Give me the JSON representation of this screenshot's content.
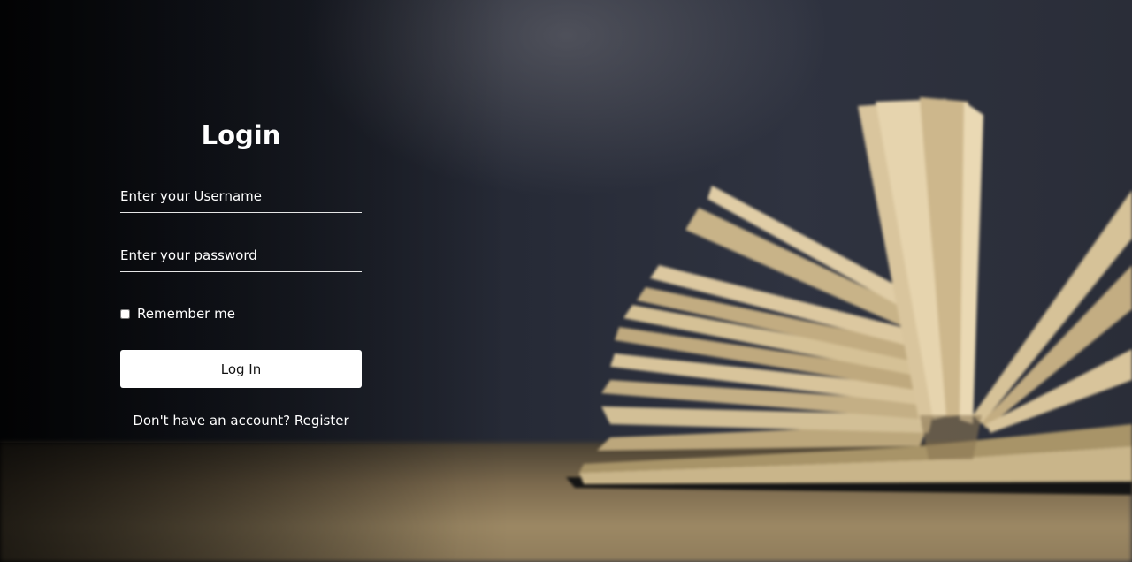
{
  "login": {
    "title": "Login",
    "username_placeholder": "Enter your Username",
    "password_placeholder": "Enter your password",
    "remember_label": "Remember me",
    "submit_label": "Log In",
    "register_prompt": "Don't have an account?",
    "register_link": "Register"
  },
  "colors": {
    "text": "#ffffff",
    "button_bg": "#ffffff",
    "button_text": "#111111"
  }
}
